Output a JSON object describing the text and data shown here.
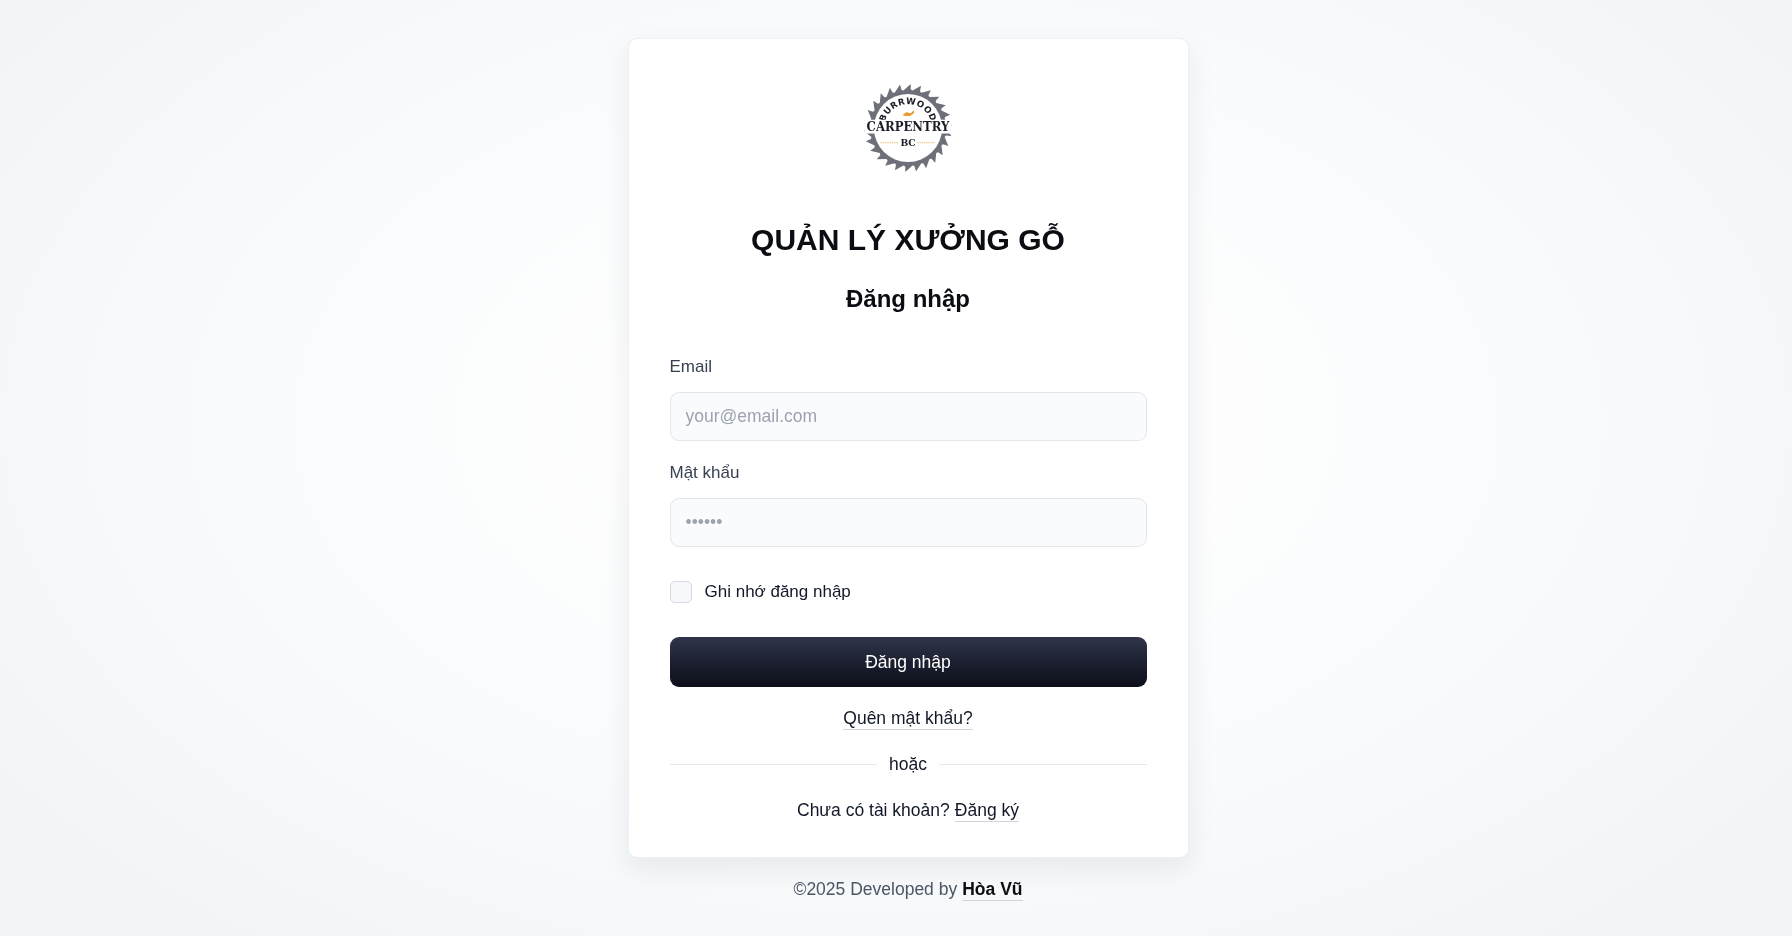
{
  "logo": {
    "arc_text": "BURRWOOD",
    "name": "CARPENTRY",
    "monogram": "BC"
  },
  "app_title": "QUẢN LÝ XƯỞNG GỖ",
  "form_title": "Đăng nhập",
  "fields": [
    {
      "label": "Email",
      "placeholder": "your@email.com"
    },
    {
      "label": "Mật khẩu",
      "placeholder": "••••••"
    }
  ],
  "remember": {
    "label": "Ghi nhớ đăng nhập",
    "checked": false
  },
  "submit_button": "Đăng nhập",
  "forgot_link": "Quên mật khẩu?",
  "divider_text": "hoặc",
  "signup": {
    "prompt": "Chưa có tài khoản?",
    "link": "Đăng ký"
  },
  "footer": {
    "text": "©2025 Developed by",
    "author": "Hòa Vũ"
  }
}
